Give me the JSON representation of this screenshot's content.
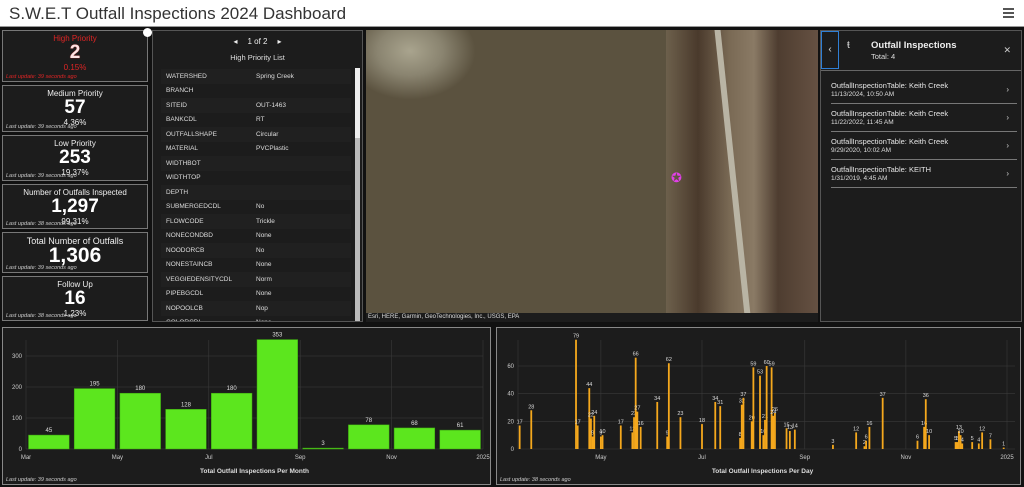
{
  "header": {
    "title": "S.W.E.T Outfall Inspections 2024 Dashboard",
    "menu_icon": "hamburger-icon"
  },
  "cards": [
    {
      "title": "High Priority",
      "value": "2",
      "percent": "0.15%",
      "update": "Last update: 39 seconds ago",
      "color": "#e02525"
    },
    {
      "title": "Medium Priority",
      "value": "57",
      "percent": "4.36%",
      "update": "Last update: 39 seconds ago"
    },
    {
      "title": "Low Priority",
      "value": "253",
      "percent": "19.37%",
      "update": "Last update: 39 seconds ago"
    },
    {
      "title": "Number of Outfalls Inspected",
      "value": "1,297",
      "percent": "99.31%",
      "update": "Last update: 38 seconds ago"
    },
    {
      "title": "Total Number of Outfalls",
      "value": "1,306",
      "update": "Last update: 39 seconds ago"
    },
    {
      "title": "Follow Up",
      "value": "16",
      "percent": "1.23%",
      "update": "Last update: 38 seconds ago"
    }
  ],
  "list": {
    "pager": "1 of 2",
    "title": "High Priority List",
    "rows": [
      [
        "WATERSHED",
        "Spring Creek"
      ],
      [
        "BRANCH",
        ""
      ],
      [
        "SITEID",
        "OUT-1463"
      ],
      [
        "BANKCDL",
        "RT"
      ],
      [
        "OUTFALLSHAPE",
        "Circular"
      ],
      [
        "MATERIAL",
        "PVCPlastic"
      ],
      [
        "WIDTHBOT",
        ""
      ],
      [
        "WIDTHTOP",
        ""
      ],
      [
        "DEPTH",
        ""
      ],
      [
        "SUBMERGEDCDL",
        "No"
      ],
      [
        "FLOWCODE",
        "Trickle"
      ],
      [
        "NONECONDBD",
        "None"
      ],
      [
        "NOODORCB",
        "No"
      ],
      [
        "NONESTAINCB",
        "None"
      ],
      [
        "VEGGIEDENSITYCDL",
        "Norm"
      ],
      [
        "PIPEBGCDL",
        "None"
      ],
      [
        "NOPOOLCB",
        "Nop"
      ],
      [
        "COLORCDL",
        "None"
      ]
    ]
  },
  "map": {
    "attribution": "Esri, HERE, Garmin, GeoTechnologies, Inc., USGS, EPA"
  },
  "popup": {
    "title": "Outfall Inspections",
    "total": "Total: 4",
    "items": [
      {
        "name": "OutfallInspectionTable: Keith Creek",
        "date": "11/13/2024, 10:50 AM"
      },
      {
        "name": "OutfallInspectionTable: Keith Creek",
        "date": "11/22/2022, 11:45 AM"
      },
      {
        "name": "OutfallInspectionTable: Keith Creek",
        "date": "9/29/2020, 10:02 AM"
      },
      {
        "name": "OutfallInspectionTable: KEITH",
        "date": "1/31/2019, 4:45 AM"
      }
    ]
  },
  "chart_data": [
    {
      "type": "bar",
      "title": "Total Outfall Inspections Per Month",
      "update": "Last update: 39 seconds ago",
      "color": "#5ce61e",
      "categories": [
        "Mar",
        "Apr",
        "May",
        "Jun",
        "Jul",
        "Aug",
        "Sep",
        "Oct",
        "Nov",
        "Dec"
      ],
      "values": [
        45,
        195,
        180,
        128,
        180,
        353,
        3,
        78,
        68,
        61
      ],
      "xticks": [
        "Mar",
        "May",
        "Jul",
        "Sep",
        "Nov",
        "2025"
      ],
      "yticks": [
        0,
        100,
        200,
        300
      ],
      "ylim": [
        0,
        353
      ]
    },
    {
      "type": "bar",
      "title": "Total Outfall Inspections Per Day",
      "update": "Last update: 38 seconds ago",
      "color": "#f5a81d",
      "x_unit": "day of year 2024",
      "xlim": [
        72,
        367
      ],
      "xticks": [
        {
          "label": "May",
          "day": 122
        },
        {
          "label": "Jul",
          "day": 183
        },
        {
          "label": "Sep",
          "day": 245
        },
        {
          "label": "Nov",
          "day": 306
        },
        {
          "label": "2025",
          "day": 367
        }
      ],
      "yticks": [
        0,
        20,
        40,
        60
      ],
      "ylim": [
        0,
        79
      ],
      "points": [
        [
          73,
          17
        ],
        [
          80,
          28
        ],
        [
          107,
          79
        ],
        [
          108,
          17
        ],
        [
          115,
          44
        ],
        [
          116,
          22
        ],
        [
          117,
          9
        ],
        [
          118,
          24
        ],
        [
          122,
          9
        ],
        [
          123,
          10
        ],
        [
          134,
          17
        ],
        [
          141,
          12
        ],
        [
          142,
          23
        ],
        [
          143,
          66
        ],
        [
          144,
          27
        ],
        [
          146,
          16
        ],
        [
          156,
          34
        ],
        [
          162,
          9
        ],
        [
          163,
          62
        ],
        [
          170,
          23
        ],
        [
          183,
          18
        ],
        [
          191,
          34
        ],
        [
          194,
          31
        ],
        [
          206,
          8
        ],
        [
          207,
          32
        ],
        [
          208,
          37
        ],
        [
          213,
          20
        ],
        [
          214,
          59
        ],
        [
          218,
          53
        ],
        [
          220,
          10
        ],
        [
          221,
          21
        ],
        [
          222,
          60
        ],
        [
          225,
          59
        ],
        [
          226,
          24
        ],
        [
          227,
          26
        ],
        [
          234,
          15
        ],
        [
          236,
          13
        ],
        [
          239,
          14
        ],
        [
          262,
          3
        ],
        [
          276,
          12
        ],
        [
          281,
          2
        ],
        [
          282,
          6
        ],
        [
          284,
          16
        ],
        [
          292,
          37
        ],
        [
          313,
          6
        ],
        [
          317,
          16
        ],
        [
          318,
          36
        ],
        [
          320,
          10
        ],
        [
          336,
          5
        ],
        [
          337,
          5
        ],
        [
          338,
          13
        ],
        [
          339,
          10
        ],
        [
          340,
          4
        ],
        [
          346,
          5
        ],
        [
          350,
          4
        ],
        [
          352,
          12
        ],
        [
          357,
          7
        ],
        [
          365,
          1
        ]
      ]
    }
  ]
}
